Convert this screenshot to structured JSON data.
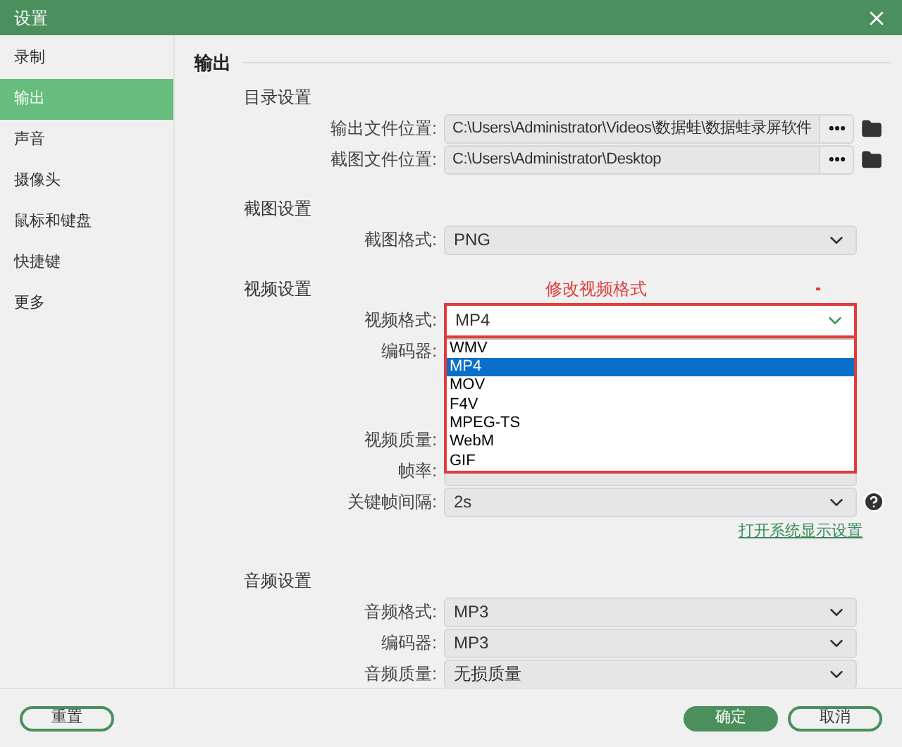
{
  "window": {
    "title": "设置"
  },
  "sidebar": {
    "items": [
      {
        "label": "录制",
        "selected": false
      },
      {
        "label": "输出",
        "selected": true
      },
      {
        "label": "声音",
        "selected": false
      },
      {
        "label": "摄像头",
        "selected": false
      },
      {
        "label": "鼠标和键盘",
        "selected": false
      },
      {
        "label": "快捷键",
        "selected": false
      },
      {
        "label": "更多",
        "selected": false
      }
    ]
  },
  "content": {
    "title": "输出",
    "sections": [
      {
        "title": "目录设置",
        "rows": [
          {
            "kind": "path",
            "label": "输出文件位置:",
            "value": "C:\\Users\\Administrator\\Videos\\数据蛙\\数据蛙录屏软件"
          },
          {
            "kind": "path",
            "label": "截图文件位置:",
            "value": "C:\\Users\\Administrator\\Desktop"
          }
        ]
      },
      {
        "title": "截图设置",
        "rows": [
          {
            "kind": "select",
            "label": "截图格式:",
            "value": "PNG"
          }
        ]
      },
      {
        "title": "视频设置",
        "annotation": "修改视频格式",
        "rows": [
          {
            "kind": "open_select",
            "label": "视频格式:",
            "value": "MP4",
            "options": [
              {
                "label": "WMV",
                "selected": false
              },
              {
                "label": "MP4",
                "selected": true
              },
              {
                "label": "MOV",
                "selected": false
              },
              {
                "label": "F4V",
                "selected": false
              },
              {
                "label": "MPEG-TS",
                "selected": false
              },
              {
                "label": "WebM",
                "selected": false
              },
              {
                "label": "GIF",
                "selected": false
              }
            ]
          },
          {
            "kind": "covered",
            "label": "编码器:"
          },
          {
            "kind": "spacer"
          },
          {
            "kind": "covered",
            "label": "视频质量:"
          },
          {
            "kind": "covered_select",
            "label": "帧率:"
          },
          {
            "kind": "help_select",
            "label": "关键帧间隔:",
            "value": "2s"
          },
          {
            "kind": "link",
            "value": "打开系统显示设置"
          }
        ]
      },
      {
        "title": "音频设置",
        "rows": [
          {
            "kind": "select",
            "label": "音频格式:",
            "value": "MP3"
          },
          {
            "kind": "select",
            "label": "编码器:",
            "value": "MP3"
          },
          {
            "kind": "select",
            "label": "音频质量:",
            "value": "无损质量"
          }
        ]
      }
    ]
  },
  "footer": {
    "reset": "重置",
    "ok": "确定",
    "cancel": "取消"
  }
}
